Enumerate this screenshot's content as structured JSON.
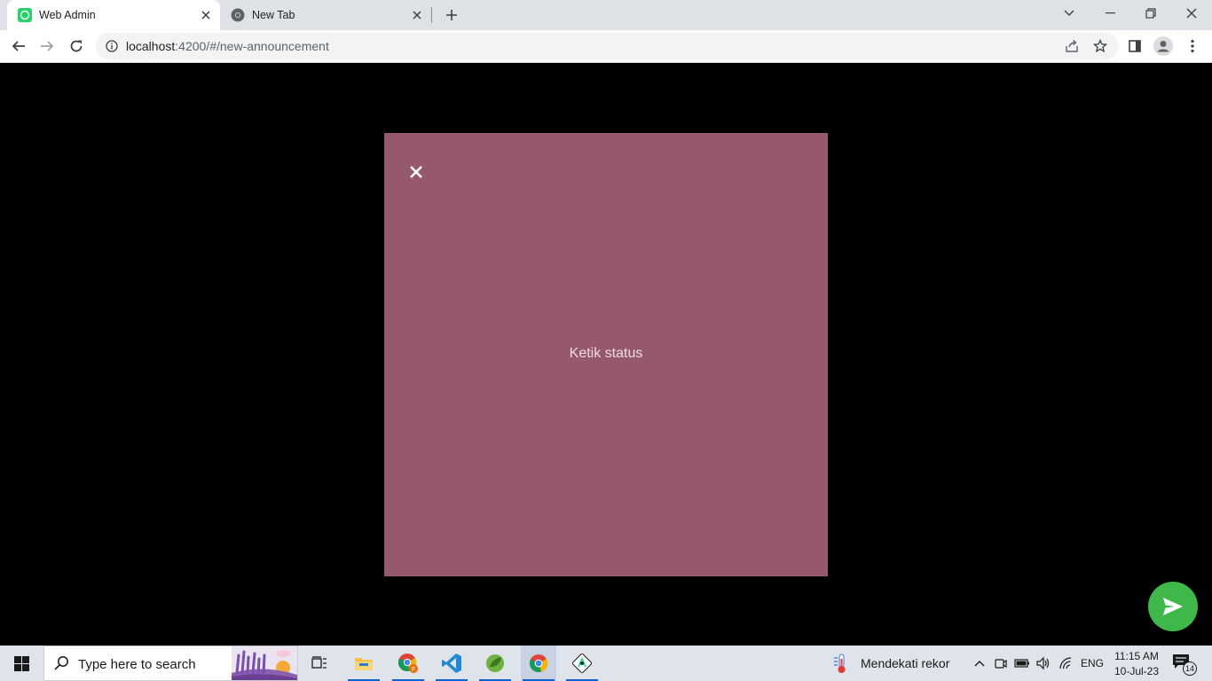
{
  "browser": {
    "tabs": [
      {
        "title": "Web Admin",
        "icon": "whatsapp-favicon",
        "active": true
      },
      {
        "title": "New Tab",
        "icon": "chrome-favicon",
        "active": false
      }
    ],
    "url_host": "localhost",
    "url_path": ":4200/#/new-announcement"
  },
  "status_editor": {
    "background_color": "#95586d",
    "placeholder": "Ketik status"
  },
  "send_button": {
    "color": "#3fb84a",
    "icon": "send-icon"
  },
  "taskbar": {
    "search_placeholder": "Type here to search",
    "weather_text": "Mendekati rekor",
    "language": "ENG",
    "time": "11:15 AM",
    "date": "10-Jul-23",
    "notification_count": "14",
    "apps": [
      "task-view",
      "file-explorer",
      "chrome-profile",
      "vscode",
      "spring-tools",
      "chrome",
      "android-studio"
    ]
  }
}
